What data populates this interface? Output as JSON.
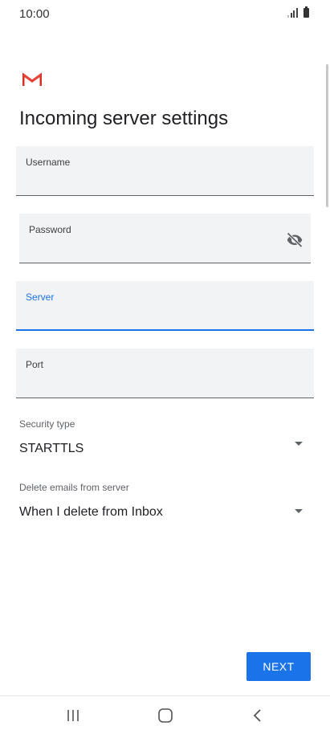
{
  "status_bar": {
    "time": "10:00",
    "signal_icon": "signal-bars-icon",
    "battery_icon": "battery-icon"
  },
  "app": {
    "logo_icon": "gmail-logo-icon",
    "logo_color": "#d93025"
  },
  "page": {
    "title": "Incoming server settings"
  },
  "form": {
    "username": {
      "label": "Username",
      "value": ""
    },
    "password": {
      "label": "Password",
      "value": "",
      "toggle_icon": "visibility-off-icon"
    },
    "server": {
      "label": "Server",
      "value": "",
      "focused": true
    },
    "port": {
      "label": "Port",
      "value": ""
    },
    "security_type": {
      "label": "Security type",
      "value": "STARTTLS"
    },
    "delete_emails": {
      "label": "Delete emails from server",
      "value": "When I delete from Inbox"
    }
  },
  "actions": {
    "next_label": "NEXT"
  },
  "colors": {
    "accent": "#1a73e8",
    "field_bg": "#f1f3f4"
  },
  "nav": {
    "recents_icon": "recents-icon",
    "home_icon": "home-icon",
    "back_icon": "back-icon"
  }
}
